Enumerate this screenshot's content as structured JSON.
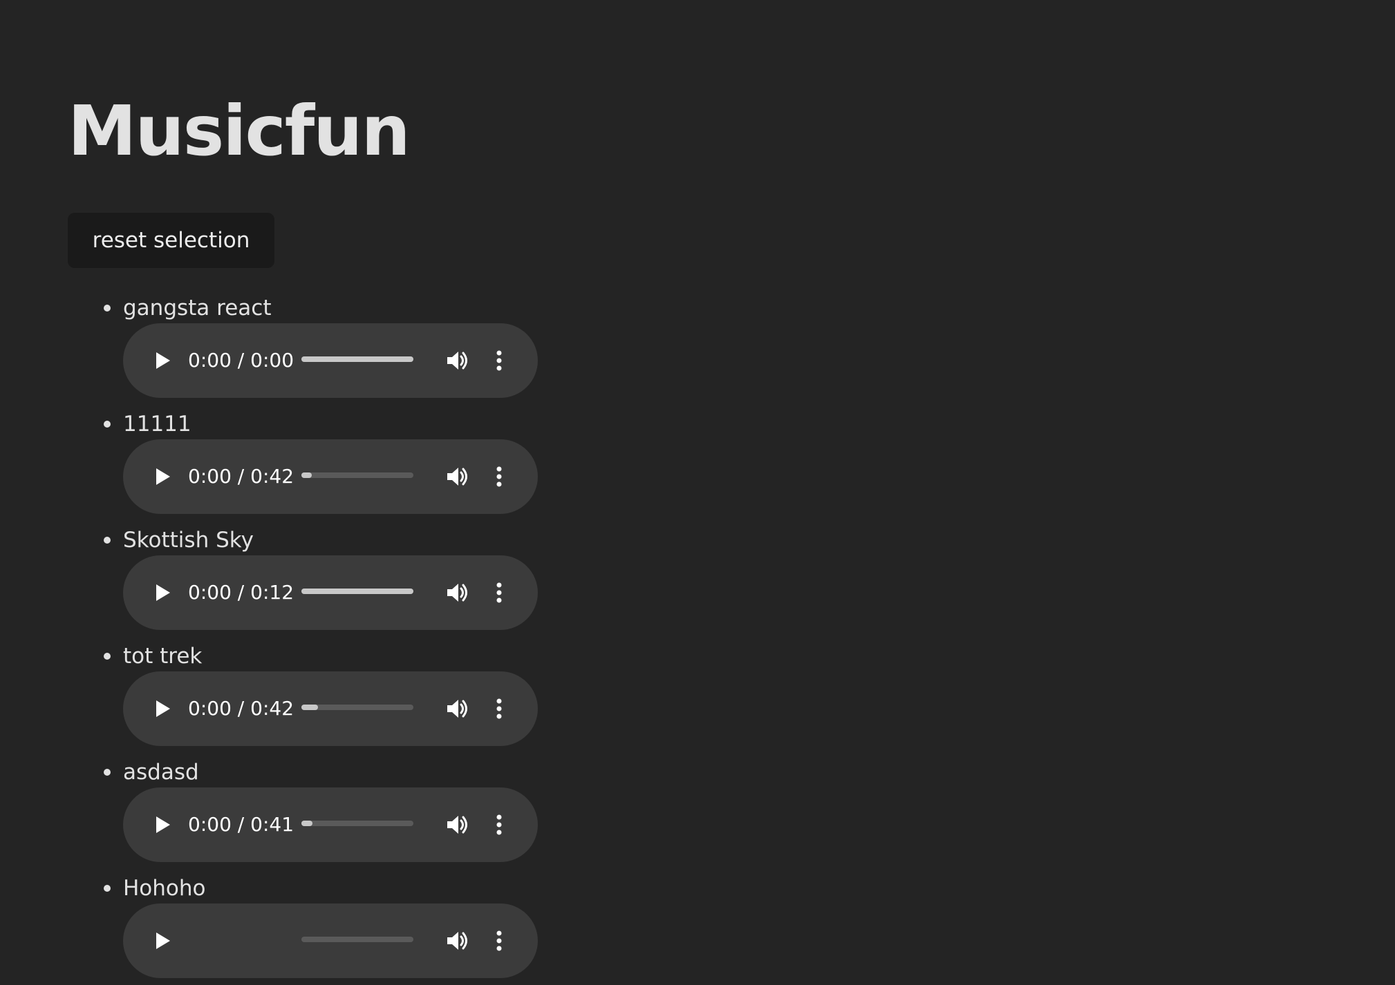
{
  "page": {
    "title": "Musicfun",
    "reset_label": "reset selection"
  },
  "icons": {
    "play": "play-icon",
    "volume": "volume-icon",
    "more": "more-options-icon"
  },
  "colors": {
    "background": "#242424",
    "player_background": "#3b3b3b",
    "button_background": "#1a1a1a"
  },
  "tracks": [
    {
      "title": "gangsta react",
      "current_time": "0:00",
      "separator": " / ",
      "duration": "0:00",
      "progress": 1.0
    },
    {
      "title": "11111",
      "current_time": "0:00",
      "separator": " / ",
      "duration": "0:42",
      "progress": 0.09
    },
    {
      "title": "Skottish Sky",
      "current_time": "0:00",
      "separator": " / ",
      "duration": "0:12",
      "progress": 1.0
    },
    {
      "title": "tot trek",
      "current_time": "0:00",
      "separator": " / ",
      "duration": "0:42",
      "progress": 0.15
    },
    {
      "title": "asdasd",
      "current_time": "0:00",
      "separator": " / ",
      "duration": "0:41",
      "progress": 0.1
    },
    {
      "title": "Hohoho",
      "current_time": "",
      "separator": "",
      "duration": "",
      "progress": 0
    }
  ]
}
